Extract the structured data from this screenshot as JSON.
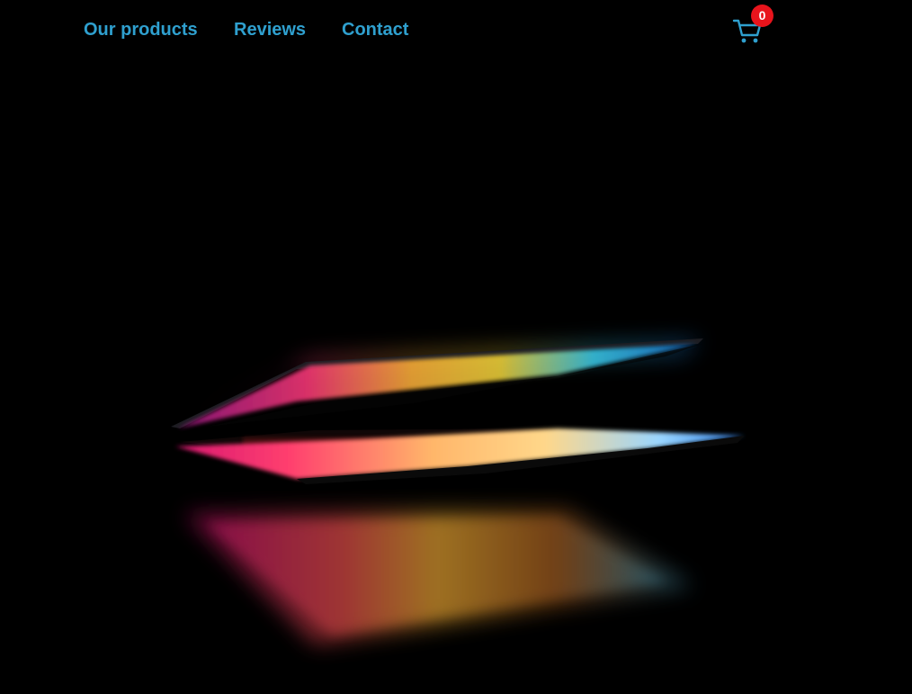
{
  "nav": {
    "links": [
      {
        "label": "Our products"
      },
      {
        "label": "Reviews"
      },
      {
        "label": "Contact"
      }
    ],
    "link_color": "#2fa0cf"
  },
  "cart": {
    "icon": "cart-icon",
    "count": "0",
    "badge_color": "#e8141c",
    "icon_color": "#2fa0cf"
  },
  "hero": {
    "background": "#000000",
    "subject": "laptop-illustration"
  }
}
